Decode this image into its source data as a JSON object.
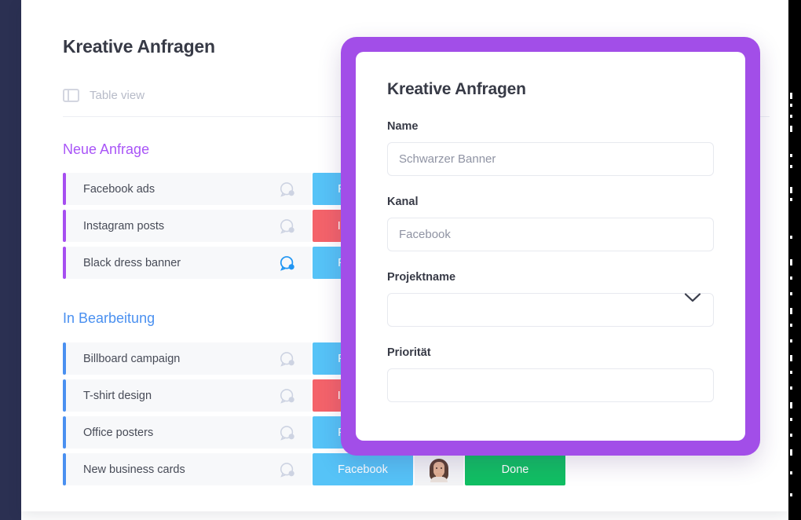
{
  "app": {
    "page_title": "Kreative Anfragen",
    "view_switch": {
      "icon": "table-view-icon",
      "label": "Table view"
    }
  },
  "colors": {
    "rail": "#2b3052",
    "accent_purple": "#a955f7",
    "accent_blue": "#4a90f0",
    "modal_border_purple": "#a24ee8",
    "tag_facebook": "#56c3f7",
    "tag_instagram": "#f4636a",
    "status_done": "#11bf63",
    "chat_active": "#2196f3",
    "chat_muted": "#cdd3e2"
  },
  "groups": [
    {
      "title": "Neue Anfrage",
      "color": "purple",
      "rows": [
        {
          "name": "Facebook ads",
          "chat": "chat-bubble-icon",
          "chat_state": "muted",
          "tag": "Facebook",
          "tag_style": "facebook",
          "status": "",
          "avatar": false
        },
        {
          "name": "Instagram posts",
          "chat": "chat-bubble-icon",
          "chat_state": "muted",
          "tag": "Instagram",
          "tag_style": "instagram",
          "status": "",
          "avatar": false
        },
        {
          "name": "Black dress banner",
          "chat": "chat-bubble-icon",
          "chat_state": "active",
          "tag": "Facebook",
          "tag_style": "facebook",
          "status": "",
          "avatar": false
        }
      ]
    },
    {
      "title": "In Bearbeitung",
      "color": "blue",
      "rows": [
        {
          "name": "Billboard campaign",
          "chat": "chat-bubble-icon",
          "chat_state": "muted",
          "tag": "Facebook",
          "tag_style": "facebook",
          "status": "",
          "avatar": false
        },
        {
          "name": "T-shirt design",
          "chat": "chat-bubble-icon",
          "chat_state": "muted",
          "tag": "Instagram",
          "tag_style": "instagram",
          "status": "",
          "avatar": false
        },
        {
          "name": "Office posters",
          "chat": "chat-bubble-icon",
          "chat_state": "muted",
          "tag": "Facebook",
          "tag_style": "facebook",
          "status": "",
          "avatar": false
        },
        {
          "name": "New business cards",
          "chat": "chat-bubble-icon",
          "chat_state": "muted",
          "tag": "Facebook",
          "tag_style": "facebook",
          "status": "Done",
          "avatar": true
        }
      ]
    }
  ],
  "modal": {
    "title": "Kreative Anfragen",
    "fields": [
      {
        "label": "Name",
        "value": "",
        "placeholder": "Schwarzer Banner",
        "type": "text"
      },
      {
        "label": "Kanal",
        "value": "",
        "placeholder": "Facebook",
        "type": "text"
      },
      {
        "label": "Projektname",
        "value": "",
        "placeholder": "",
        "type": "select"
      },
      {
        "label": "Priorität",
        "value": "",
        "placeholder": "",
        "type": "text"
      }
    ]
  }
}
